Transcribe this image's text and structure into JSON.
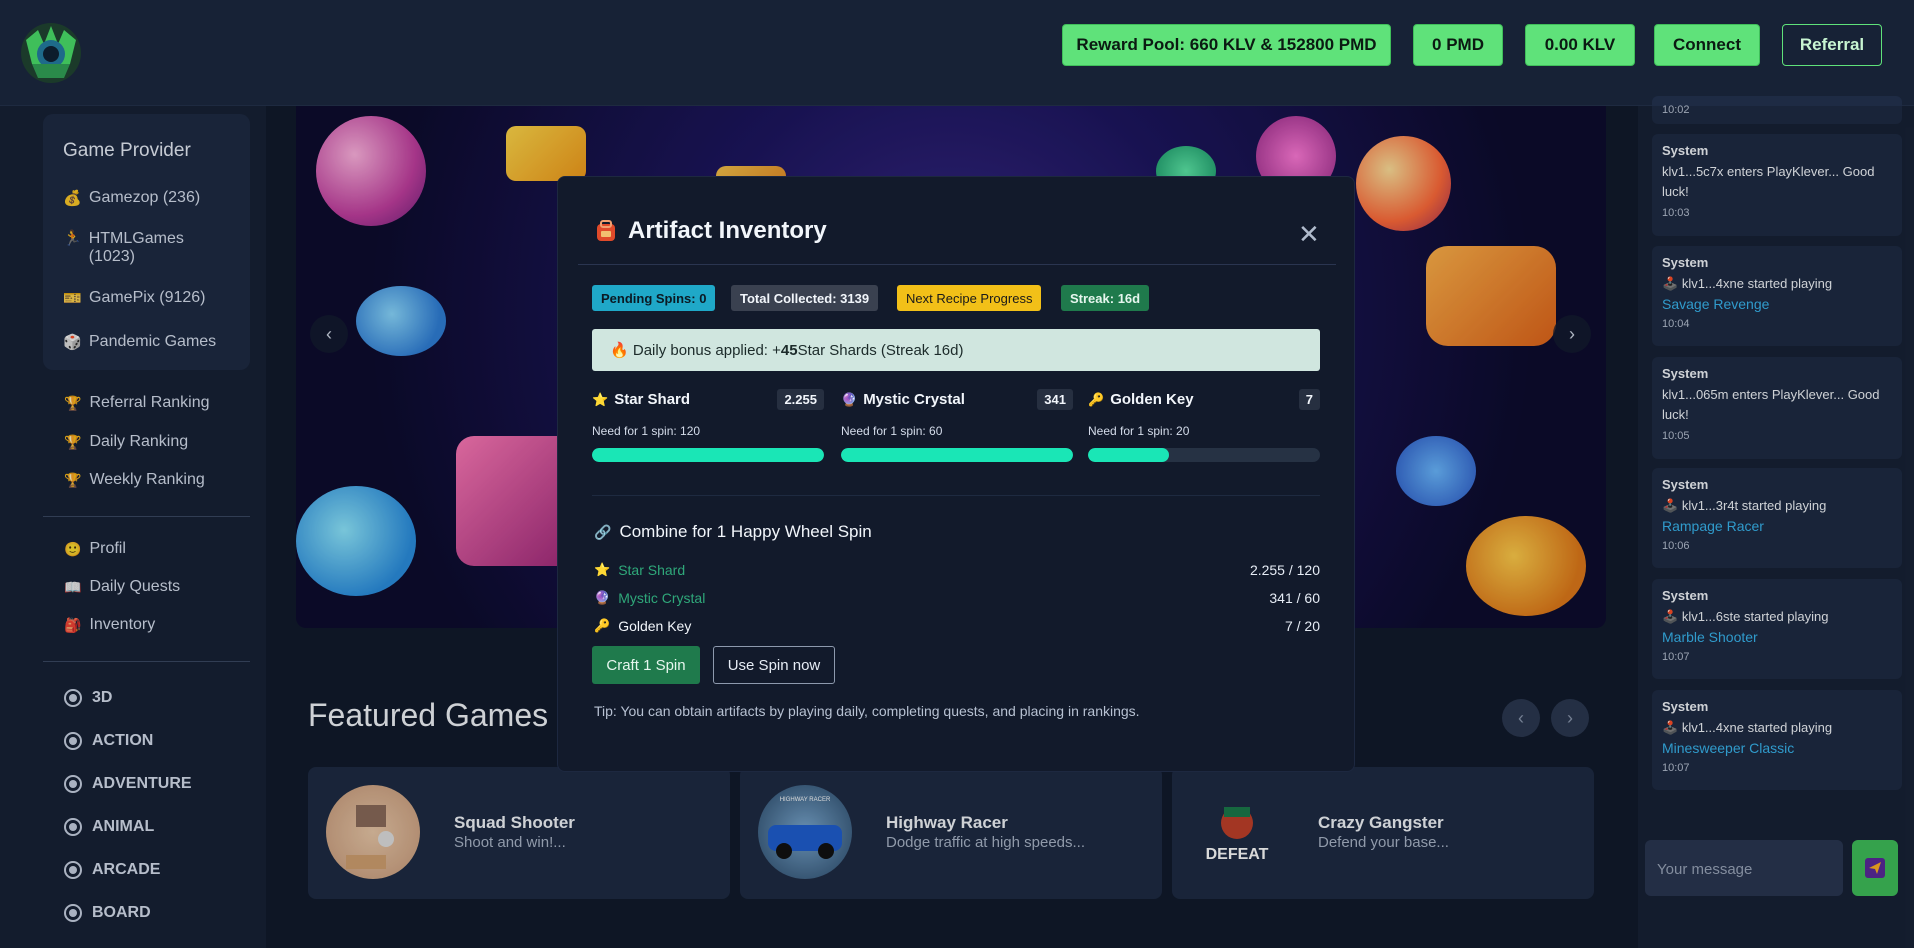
{
  "header": {
    "reward_pool_label": "Reward Pool:",
    "reward_pool_value": "660 KLV & 152800 PMD",
    "pmd_balance": "0 PMD",
    "klv_balance": "0.00 KLV",
    "connect_label": "Connect",
    "referral_label": "Referral"
  },
  "sidebar": {
    "provider_title": "Game Provider",
    "providers": [
      {
        "icon": "money-bag-icon",
        "label": "Gamezop (236)"
      },
      {
        "icon": "runner-icon",
        "label": "HTMLGames (1023)"
      },
      {
        "icon": "ticket-icon",
        "label": "GamePix (9126)"
      },
      {
        "icon": "dice-icon",
        "label": "Pandemic Games"
      }
    ],
    "rankings": [
      {
        "icon": "trophy-icon",
        "label": "Referral Ranking"
      },
      {
        "icon": "trophy-icon",
        "label": "Daily Ranking"
      },
      {
        "icon": "trophy-icon",
        "label": "Weekly Ranking"
      }
    ],
    "account": [
      {
        "icon": "face-icon",
        "label": "Profil"
      },
      {
        "icon": "book-icon",
        "label": "Daily Quests"
      },
      {
        "icon": "backpack-icon",
        "label": "Inventory"
      }
    ],
    "categories": [
      "3D",
      "ACTION",
      "ADVENTURE",
      "ANIMAL",
      "ARCADE",
      "BOARD"
    ]
  },
  "main": {
    "featured_title": "Featured Games",
    "games": [
      {
        "name": "Squad Shooter",
        "desc": "Shoot and win!..."
      },
      {
        "name": "Highway Racer",
        "desc": "Dodge traffic at high speeds...",
        "thumb_caption": "HIGHWAY RACER"
      },
      {
        "name": "Crazy Gangster",
        "desc": "Defend your base...",
        "thumb_caption": "DEFEAT"
      }
    ]
  },
  "chat": {
    "top_time": "10:02",
    "messages": [
      {
        "sender": "System",
        "text": "klv1...5c7x enters PlayKlever... Good luck!",
        "game": "",
        "time": "10:03"
      },
      {
        "sender": "System",
        "text": "klv1...4xne started playing",
        "game": "Savage Revenge",
        "time": "10:04"
      },
      {
        "sender": "System",
        "text": "klv1...065m enters PlayKlever... Good luck!",
        "game": "",
        "time": "10:05"
      },
      {
        "sender": "System",
        "text": "klv1...3r4t started playing",
        "game": "Rampage Racer",
        "time": "10:06"
      },
      {
        "sender": "System",
        "text": "klv1...6ste started playing",
        "game": "Marble Shooter",
        "time": "10:07"
      },
      {
        "sender": "System",
        "text": "klv1...4xne started playing",
        "game": "Minesweeper Classic",
        "time": "10:07"
      }
    ],
    "input_placeholder": "Your message"
  },
  "modal": {
    "title": "Artifact Inventory",
    "badges": {
      "pending": "Pending Spins: 0",
      "total": "Total Collected: 3139",
      "next": "Next Recipe Progress",
      "streak": "Streak: 16d"
    },
    "bonus_prefix": "Daily bonus applied: +",
    "bonus_amount": "45",
    "bonus_suffix": " Star Shards (Streak 16d)",
    "artifacts": [
      {
        "name": "Star Shard",
        "count": "2.255",
        "need": "Need for 1 spin: 120",
        "progress": 1.0
      },
      {
        "name": "Mystic Crystal",
        "count": "341",
        "need": "Need for 1 spin: 60",
        "progress": 1.0
      },
      {
        "name": "Golden Key",
        "count": "7",
        "need": "Need for 1 spin: 20",
        "progress": 0.35
      }
    ],
    "combine_label": "Combine for 1 Happy Wheel Spin",
    "recipe": [
      {
        "name": "Star Shard",
        "value": "2.255 / 120",
        "color": "#2fa87a"
      },
      {
        "name": "Mystic Crystal",
        "value": "341 / 60",
        "color": "#2fa87a"
      },
      {
        "name": "Golden Key",
        "value": "7 / 20",
        "color": "#f2f6fb"
      }
    ],
    "craft_label": "Craft 1 Spin",
    "use_label": "Use Spin now",
    "tip": "Tip: You can obtain artifacts by playing daily, completing quests, and placing in rankings."
  }
}
